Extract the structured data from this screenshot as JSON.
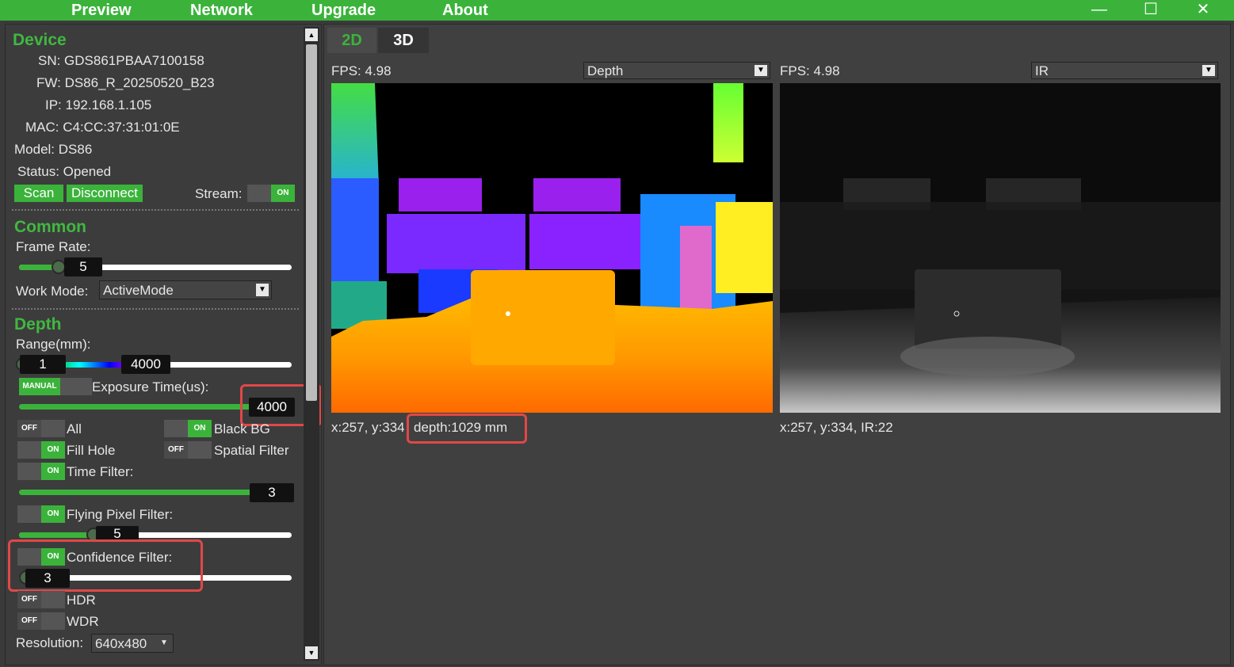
{
  "menu": {
    "preview": "Preview",
    "network": "Network",
    "upgrade": "Upgrade",
    "about": "About"
  },
  "window": {
    "minimize": "—",
    "maximize": "☐",
    "close": "✕"
  },
  "device": {
    "title": "Device",
    "sn": "SN: GDS861PBAA7100158",
    "fw": "FW: DS86_R_20250520_B23",
    "ip": "IP: 192.168.1.105",
    "mac": "MAC: C4:CC:37:31:01:0E",
    "model": "Model: DS86",
    "status": "Status: Opened",
    "scan": "Scan",
    "disconnect": "Disconnect",
    "stream_label": "Stream:",
    "stream_state": "ON"
  },
  "common": {
    "title": "Common",
    "frame_rate_label": "Frame Rate:",
    "frame_rate_value": "5",
    "work_mode_label": "Work Mode:",
    "work_mode_value": "ActiveMode"
  },
  "depth": {
    "title": "Depth",
    "range_label": "Range(mm):",
    "range_min": "1",
    "range_max": "4000",
    "exposure_mode": "MANUAL",
    "exposure_label": "Exposure Time(us):",
    "exposure_value": "4000",
    "all_state": "OFF",
    "all_label": "All",
    "black_bg_state": "ON",
    "black_bg_label": "Black BG",
    "fill_hole_state": "ON",
    "fill_hole_label": "Fill Hole",
    "spatial_state": "OFF",
    "spatial_label": "Spatial Filter",
    "time_filter_state": "ON",
    "time_filter_label": "Time Filter:",
    "time_filter_value": "3",
    "flying_state": "ON",
    "flying_label": "Flying Pixel Filter:",
    "flying_value": "5",
    "confidence_state": "ON",
    "confidence_label": "Confidence Filter:",
    "confidence_value": "3",
    "hdr_state": "OFF",
    "hdr_label": "HDR",
    "wdr_state": "OFF",
    "wdr_label": "WDR",
    "resolution_label": "Resolution:",
    "resolution_value": "640x480"
  },
  "tabs": {
    "tab2d": "2D",
    "tab3d": "3D"
  },
  "left_view": {
    "fps": "FPS: 4.98",
    "mode": "Depth",
    "coord": "x:257, y:334",
    "depth": "depth:1029 mm"
  },
  "right_view": {
    "fps": "FPS: 4.98",
    "mode": "IR",
    "coord": "x:257, y:334, IR:22"
  },
  "colors": {
    "accent": "#3bb33b",
    "highlight": "#e04848"
  }
}
